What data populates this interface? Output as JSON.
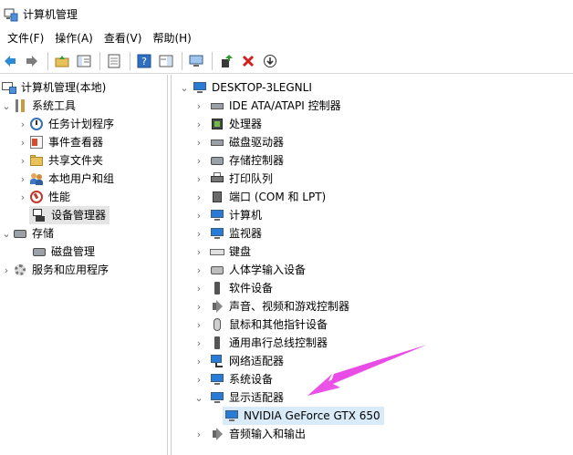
{
  "window": {
    "title": "计算机管理"
  },
  "menubar": [
    "文件(F)",
    "操作(A)",
    "查看(V)",
    "帮助(H)"
  ],
  "toolbar": {
    "buttons": [
      "back-arrow-icon",
      "forward-arrow-icon",
      "up-folder-icon",
      "show-hide-tree-icon",
      "properties-icon",
      "help-icon",
      "action-pane-icon",
      "computer-icon",
      "update-driver-icon",
      "uninstall-icon",
      "download-icon"
    ]
  },
  "left_tree": {
    "root": "计算机管理(本地)",
    "system_tools": "系统工具",
    "task_scheduler": "任务计划程序",
    "event_viewer": "事件查看器",
    "shared_folders": "共享文件夹",
    "local_users": "本地用户和组",
    "performance": "性能",
    "device_manager": "设备管理器",
    "storage": "存储",
    "disk_management": "磁盘管理",
    "services": "服务和应用程序"
  },
  "device_tree": {
    "computer_name": "DESKTOP-3LEGNLI",
    "categories": [
      "IDE ATA/ATAPI 控制器",
      "处理器",
      "磁盘驱动器",
      "存储控制器",
      "打印队列",
      "端口 (COM 和 LPT)",
      "计算机",
      "监视器",
      "键盘",
      "人体学输入设备",
      "软件设备",
      "声音、视频和游戏控制器",
      "鼠标和其他指针设备",
      "通用串行总线控制器",
      "网络适配器",
      "系统设备",
      "显示适配器"
    ],
    "display_adapter_child": "NVIDIA GeForce GTX 650",
    "last_category": "音频输入和输出"
  },
  "colors": {
    "arrow": "#e94be6",
    "selection": "#d9ebf9"
  }
}
